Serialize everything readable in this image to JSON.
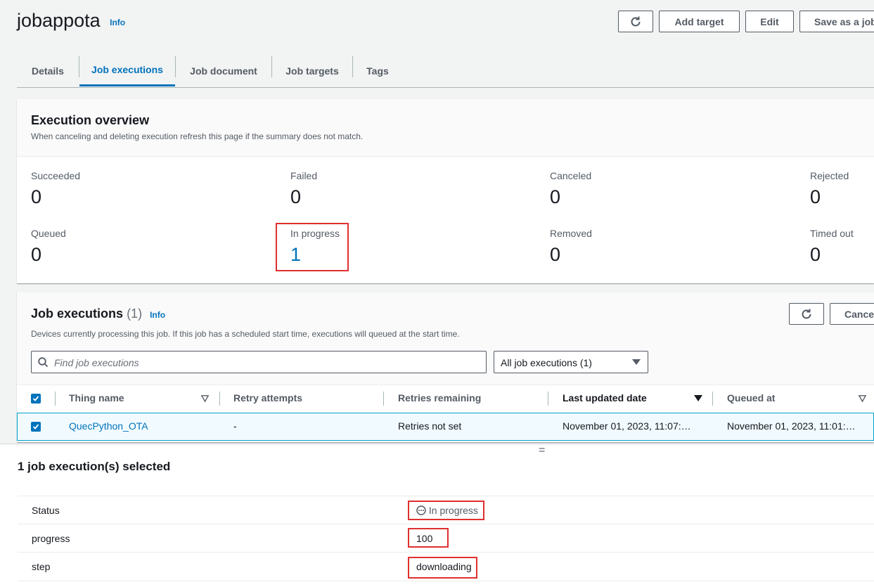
{
  "header": {
    "title": "jobappota",
    "info": "Info",
    "buttons": {
      "add_target": "Add target",
      "edit": "Edit",
      "save_as_job": "Save as a job"
    }
  },
  "tabs": [
    {
      "label": "Details"
    },
    {
      "label": "Job executions",
      "active": true
    },
    {
      "label": "Job document"
    },
    {
      "label": "Job targets"
    },
    {
      "label": "Tags"
    }
  ],
  "overview": {
    "title": "Execution overview",
    "description": "When canceling and deleting execution refresh this page if the summary does not match.",
    "stats": [
      {
        "label": "Succeeded",
        "value": "0"
      },
      {
        "label": "Failed",
        "value": "0"
      },
      {
        "label": "Canceled",
        "value": "0"
      },
      {
        "label": "Rejected",
        "value": "0"
      },
      {
        "label": "Queued",
        "value": "0"
      },
      {
        "label": "In progress",
        "value": "1"
      },
      {
        "label": "Removed",
        "value": "0"
      },
      {
        "label": "Timed out",
        "value": "0"
      }
    ]
  },
  "executions": {
    "title": "Job executions",
    "count": "(1)",
    "info": "Info",
    "description": "Devices currently processing this job. If this job has a scheduled start time, executions will queued at the start time.",
    "cancel_label": "Cancel",
    "search_placeholder": "Find job executions",
    "filter_selected": "All job executions (1)",
    "columns": [
      "Thing name",
      "Retry attempts",
      "Retries remaining",
      "Last updated date",
      "Queued at"
    ],
    "rows": [
      {
        "thing_name": "QuecPython_OTA",
        "retry_attempts": "-",
        "retries_remaining": "Retries not set",
        "last_updated": "November 01, 2023, 11:07:…",
        "queued_at": "November 01, 2023, 11:01:…"
      }
    ]
  },
  "split_handle": "=",
  "selection": {
    "title": "1 job execution(s) selected",
    "fields": [
      {
        "label": "Status",
        "value": "In progress"
      },
      {
        "label": "progress",
        "value": "100"
      },
      {
        "label": "step",
        "value": "downloading"
      }
    ]
  },
  "colors": {
    "link": "#0073bb",
    "highlight_border": "#e02f2f",
    "checkbox": "#0073bb"
  }
}
